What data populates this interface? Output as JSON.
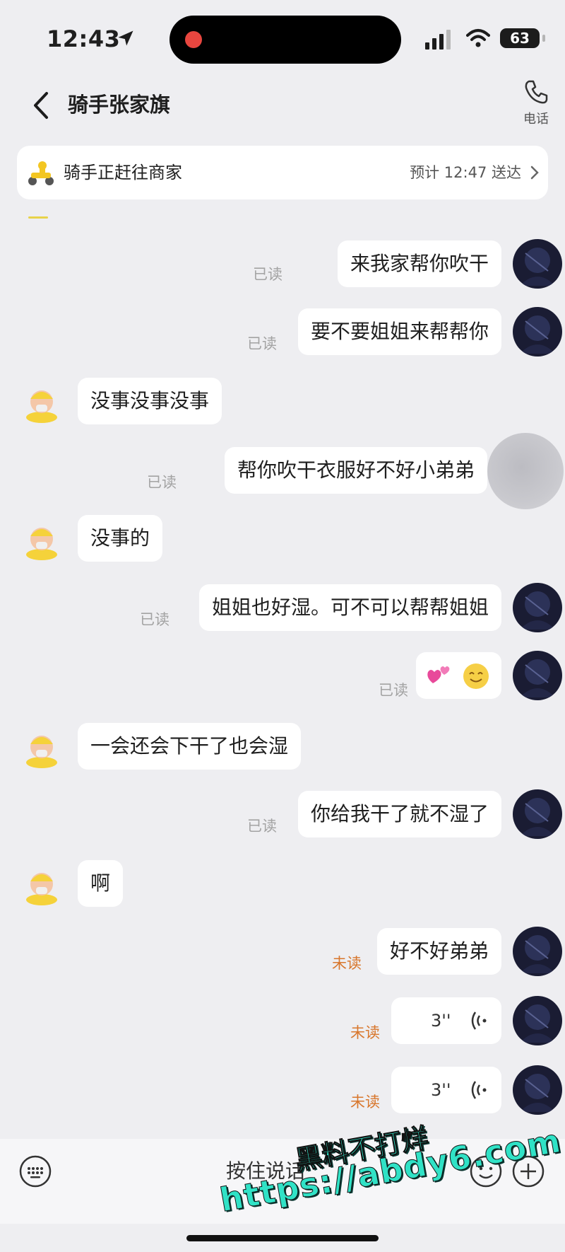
{
  "status_bar": {
    "time": "12:43",
    "battery": "63"
  },
  "header": {
    "title": "骑手张家旗",
    "phone_label": "电话"
  },
  "banner": {
    "status": "骑手正赶往商家",
    "eta": "预计 12:47 送达"
  },
  "messages": [
    {
      "side": "out",
      "text": "来我家帮你吹干",
      "read": "已读"
    },
    {
      "side": "out",
      "text": "要不要姐姐来帮帮你",
      "read": "已读"
    },
    {
      "side": "in",
      "text": "没事没事没事"
    },
    {
      "side": "out",
      "text": "帮你吹干衣服好不好小弟弟",
      "read": "已读"
    },
    {
      "side": "in",
      "text": "没事的"
    },
    {
      "side": "out",
      "text": "姐姐也好湿。可不可以帮帮姐姐",
      "read": "已读"
    },
    {
      "side": "out",
      "emoji": "💕😊",
      "read": "已读"
    },
    {
      "side": "in",
      "text": "一会还会下干了也会湿"
    },
    {
      "side": "out",
      "text": "你给我干了就不湿了",
      "read": "已读"
    },
    {
      "side": "in",
      "text": "啊"
    },
    {
      "side": "out",
      "text": "好不好弟弟",
      "read": "未读"
    },
    {
      "side": "out",
      "voice": "3''",
      "read": "未读"
    },
    {
      "side": "out",
      "voice": "3''",
      "read": "未读"
    }
  ],
  "input_bar": {
    "hold_to_talk": "按住说话"
  },
  "watermark": {
    "line1": "黑料不打烊",
    "line2": "https://abdy6.com"
  },
  "colors": {
    "unread": "#d8772d",
    "read": "#a3a3a3",
    "background": "#eeeef1",
    "watermark": "#30e2c6"
  }
}
